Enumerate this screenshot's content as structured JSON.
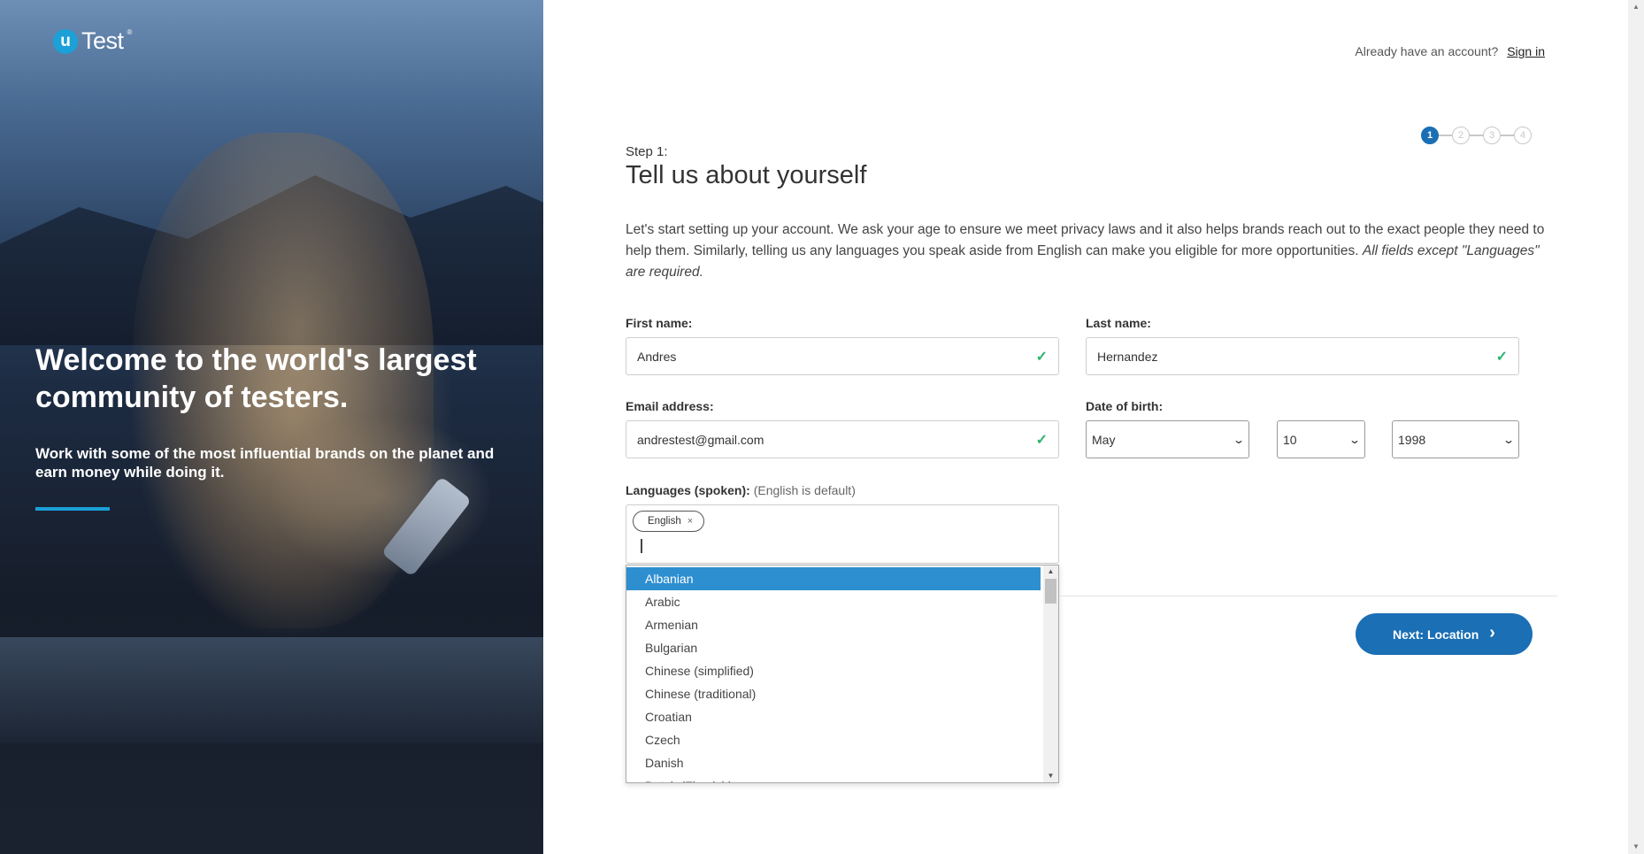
{
  "brand": {
    "logo_letter": "u",
    "logo_text": "Test",
    "logo_mark": "®"
  },
  "hero": {
    "headline": "Welcome to the world's largest community of testers.",
    "subheadline": "Work with some of the most influential brands on the planet and earn money while doing it."
  },
  "header": {
    "account_prompt": "Already have an account?",
    "sign_in_label": "Sign in"
  },
  "stepper": {
    "steps": [
      "1",
      "2",
      "3",
      "4"
    ],
    "active_step": 1
  },
  "form": {
    "step_label": "Step 1:",
    "title": "Tell us about yourself",
    "intro": "Let's start setting up your account. We ask your age to ensure we meet privacy laws and it also helps brands reach out to the exact people they need to help them. Similarly, telling us any languages you speak aside from English can make you eligible for more opportunities.",
    "intro_emphasis": "All fields except \"Languages\" are required.",
    "first_name": {
      "label": "First name:",
      "value": "Andres"
    },
    "last_name": {
      "label": "Last name:",
      "value": "Hernandez"
    },
    "email": {
      "label": "Email address:",
      "value": "andrestest@gmail.com"
    },
    "dob": {
      "label": "Date of birth:",
      "month": "May",
      "day": "10",
      "year": "1998"
    },
    "languages": {
      "label": "Languages (spoken):",
      "hint": "(English is default)",
      "selected": [
        "English"
      ],
      "remove_glyph": "×",
      "options": [
        "Albanian",
        "Arabic",
        "Armenian",
        "Bulgarian",
        "Chinese (simplified)",
        "Chinese (traditional)",
        "Croatian",
        "Czech",
        "Danish",
        "Dutch (Flemish)"
      ],
      "highlighted": "Albanian"
    },
    "next_label": "Next: Location"
  },
  "colors": {
    "accent": "#1ba0d8",
    "primary": "#1a6fb5",
    "valid": "#2db36f",
    "highlight": "#2e8fd0"
  }
}
